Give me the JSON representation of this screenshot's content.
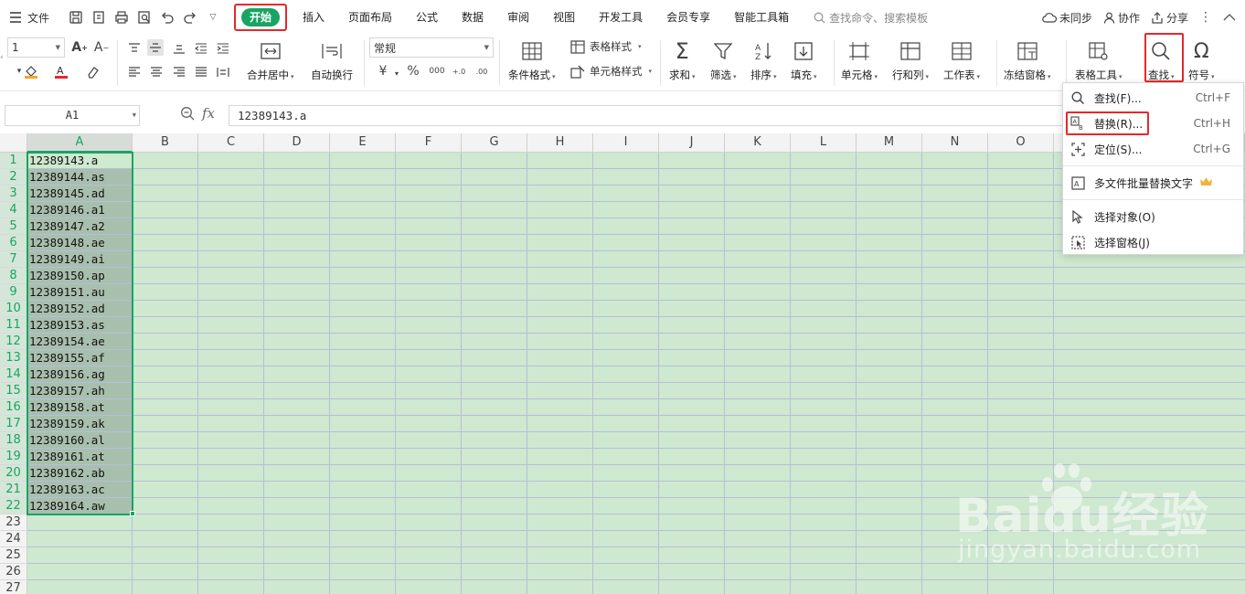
{
  "menubar": {
    "file_label": "文件",
    "tabs": [
      "插入",
      "页面布局",
      "公式",
      "数据",
      "审阅",
      "视图",
      "开发工具",
      "会员专享",
      "智能工具箱"
    ],
    "active_tab": "开始",
    "search_placeholder": "查找命令、搜索模板",
    "right": {
      "sync": "未同步",
      "collab": "协作",
      "share": "分享"
    }
  },
  "ribbon": {
    "font_size": "1",
    "number_format": "常规",
    "currency_symbol": "¥",
    "percent_symbol": "%",
    "merge_center": "合并居中",
    "auto_wrap": "自动换行",
    "table_style": "表格样式",
    "cond_format": "条件格式",
    "cell_style": "单元格样式",
    "sum": "求和",
    "filter": "筛选",
    "sort": "排序",
    "fill": "填充",
    "cell": "单元格",
    "row_col": "行和列",
    "sheet": "工作表",
    "freeze": "冻结窗格",
    "table_tools": "表格工具",
    "find": "查找",
    "symbol": "符号"
  },
  "formula_bar": {
    "name_box": "A1",
    "fx": "fx",
    "content": "12389143.a"
  },
  "sheet": {
    "columns": [
      "A",
      "B",
      "C",
      "D",
      "E",
      "F",
      "G",
      "H",
      "I",
      "J",
      "K",
      "L",
      "M",
      "N",
      "O"
    ],
    "rows": [
      "1",
      "2",
      "3",
      "4",
      "5",
      "6",
      "7",
      "8",
      "9",
      "10",
      "11",
      "12",
      "13",
      "14",
      "15",
      "16",
      "17",
      "18",
      "19",
      "20",
      "21",
      "22",
      "23",
      "24",
      "25",
      "26",
      "27"
    ],
    "cells_A": [
      "12389143.a",
      "12389144.as",
      "12389145.ad",
      "12389146.a1",
      "12389147.a2",
      "12389148.ae",
      "12389149.ai",
      "12389150.ap",
      "12389151.au",
      "12389152.ad",
      "12389153.as",
      "12389154.ae",
      "12389155.af",
      "12389156.ag",
      "12389157.ah",
      "12389158.at",
      "12389159.ak",
      "12389160.al",
      "12389161.at",
      "12389162.ab",
      "12389163.ac",
      "12389164.aw"
    ]
  },
  "find_menu": {
    "items": [
      {
        "label": "查找(F)...",
        "shortcut": "Ctrl+F",
        "icon": "search-icon"
      },
      {
        "label": "替换(R)...",
        "shortcut": "Ctrl+H",
        "icon": "replace-icon"
      },
      {
        "label": "定位(S)...",
        "shortcut": "Ctrl+G",
        "icon": "locate-icon"
      },
      {
        "label": "多文件批量替换文字",
        "shortcut": "",
        "icon": "batch-replace-icon"
      },
      {
        "label": "选择对象(O)",
        "shortcut": "",
        "icon": "cursor-icon"
      },
      {
        "label": "选择窗格(J)",
        "shortcut": "",
        "icon": "selection-pane-icon"
      }
    ]
  },
  "watermark": {
    "main": "Baidu经验",
    "sub": "jingyan.baidu.com"
  },
  "colors": {
    "accent": "#1aa463",
    "highlight": "#e5282c",
    "sheet_bg": "#cfe8d0"
  }
}
